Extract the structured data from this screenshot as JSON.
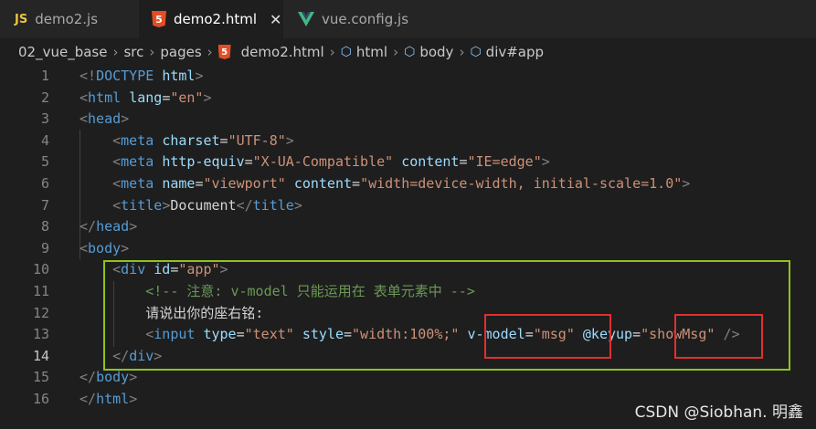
{
  "tabs": [
    {
      "icon": "js-icon",
      "icon_text": "JS",
      "label": "demo2.js",
      "active": false
    },
    {
      "icon": "html5-icon",
      "icon_text": "5",
      "label": "demo2.html",
      "active": true,
      "close": "✕"
    },
    {
      "icon": "vue-icon",
      "icon_text": "",
      "label": "vue.config.js",
      "active": false
    }
  ],
  "breadcrumb": [
    "02_vue_base",
    "src",
    "pages",
    "demo2.html",
    "html",
    "body",
    "div#app"
  ],
  "editor": {
    "current_line": 14,
    "lines": [
      {
        "n": "1",
        "t": [
          [
            "t-punc",
            "<!"
          ],
          [
            "t-tag",
            "DOCTYPE"
          ],
          [
            "t-text",
            " "
          ],
          [
            "t-attr",
            "html"
          ],
          [
            "t-punc",
            ">"
          ]
        ]
      },
      {
        "n": "2",
        "t": [
          [
            "t-punc",
            "<"
          ],
          [
            "t-tag",
            "html"
          ],
          [
            "t-text",
            " "
          ],
          [
            "t-attr",
            "lang"
          ],
          [
            "t-text",
            "="
          ],
          [
            "t-str",
            "\"en\""
          ],
          [
            "t-punc",
            ">"
          ]
        ]
      },
      {
        "n": "3",
        "t": [
          [
            "t-punc",
            "<"
          ],
          [
            "t-tag",
            "head"
          ],
          [
            "t-punc",
            ">"
          ]
        ]
      },
      {
        "n": "4",
        "t": [
          [
            "t-text",
            "    "
          ],
          [
            "t-punc",
            "<"
          ],
          [
            "t-tag",
            "meta"
          ],
          [
            "t-text",
            " "
          ],
          [
            "t-attr",
            "charset"
          ],
          [
            "t-text",
            "="
          ],
          [
            "t-str",
            "\"UTF-8\""
          ],
          [
            "t-punc",
            ">"
          ]
        ]
      },
      {
        "n": "5",
        "t": [
          [
            "t-text",
            "    "
          ],
          [
            "t-punc",
            "<"
          ],
          [
            "t-tag",
            "meta"
          ],
          [
            "t-text",
            " "
          ],
          [
            "t-attr",
            "http-equiv"
          ],
          [
            "t-text",
            "="
          ],
          [
            "t-str",
            "\"X-UA-Compatible\""
          ],
          [
            "t-text",
            " "
          ],
          [
            "t-attr",
            "content"
          ],
          [
            "t-text",
            "="
          ],
          [
            "t-str",
            "\"IE=edge\""
          ],
          [
            "t-punc",
            ">"
          ]
        ]
      },
      {
        "n": "6",
        "t": [
          [
            "t-text",
            "    "
          ],
          [
            "t-punc",
            "<"
          ],
          [
            "t-tag",
            "meta"
          ],
          [
            "t-text",
            " "
          ],
          [
            "t-attr",
            "name"
          ],
          [
            "t-text",
            "="
          ],
          [
            "t-str",
            "\"viewport\""
          ],
          [
            "t-text",
            " "
          ],
          [
            "t-attr",
            "content"
          ],
          [
            "t-text",
            "="
          ],
          [
            "t-str",
            "\"width=device-width, initial-scale=1.0\""
          ],
          [
            "t-punc",
            ">"
          ]
        ]
      },
      {
        "n": "7",
        "t": [
          [
            "t-text",
            "    "
          ],
          [
            "t-punc",
            "<"
          ],
          [
            "t-tag",
            "title"
          ],
          [
            "t-punc",
            ">"
          ],
          [
            "t-text",
            "Document"
          ],
          [
            "t-punc",
            "</"
          ],
          [
            "t-tag",
            "title"
          ],
          [
            "t-punc",
            ">"
          ]
        ]
      },
      {
        "n": "8",
        "t": [
          [
            "t-punc",
            "</"
          ],
          [
            "t-tag",
            "head"
          ],
          [
            "t-punc",
            ">"
          ]
        ]
      },
      {
        "n": "9",
        "t": [
          [
            "t-punc",
            "<"
          ],
          [
            "t-tag",
            "body"
          ],
          [
            "t-punc",
            ">"
          ]
        ]
      },
      {
        "n": "10",
        "t": [
          [
            "t-text",
            "    "
          ],
          [
            "t-punc",
            "<"
          ],
          [
            "t-tag",
            "div"
          ],
          [
            "t-text",
            " "
          ],
          [
            "t-attr",
            "id"
          ],
          [
            "t-text",
            "="
          ],
          [
            "t-str",
            "\"app\""
          ],
          [
            "t-punc",
            ">"
          ]
        ]
      },
      {
        "n": "11",
        "t": [
          [
            "t-text",
            "        "
          ],
          [
            "t-cmt",
            "<!-- 注意: v-model 只能运用在 表单元素中 -->"
          ]
        ]
      },
      {
        "n": "12",
        "t": [
          [
            "t-text",
            "        请说出你的座右铭:"
          ]
        ]
      },
      {
        "n": "13",
        "t": [
          [
            "t-text",
            "        "
          ],
          [
            "t-punc",
            "<"
          ],
          [
            "t-tag",
            "input"
          ],
          [
            "t-text",
            " "
          ],
          [
            "t-attr",
            "type"
          ],
          [
            "t-text",
            "="
          ],
          [
            "t-str",
            "\"text\""
          ],
          [
            "t-text",
            " "
          ],
          [
            "t-attr",
            "style"
          ],
          [
            "t-text",
            "="
          ],
          [
            "t-str",
            "\"width:100%;\""
          ],
          [
            "t-text",
            " "
          ],
          [
            "t-attr",
            "v-model"
          ],
          [
            "t-text",
            "="
          ],
          [
            "t-str",
            "\"msg\""
          ],
          [
            "t-text",
            " "
          ],
          [
            "t-attr",
            "@keyup"
          ],
          [
            "t-text",
            "="
          ],
          [
            "t-str",
            "\"showMsg\""
          ],
          [
            "t-text",
            " "
          ],
          [
            "t-punc",
            "/>"
          ]
        ]
      },
      {
        "n": "14",
        "t": [
          [
            "t-text",
            "    "
          ],
          [
            "t-punc",
            "</"
          ],
          [
            "t-tag",
            "div"
          ],
          [
            "t-punc",
            ">"
          ]
        ]
      },
      {
        "n": "15",
        "t": [
          [
            "t-punc",
            "</"
          ],
          [
            "t-tag",
            "body"
          ],
          [
            "t-punc",
            ">"
          ]
        ]
      },
      {
        "n": "16",
        "t": [
          [
            "t-punc",
            "</"
          ],
          [
            "t-tag",
            "html"
          ],
          [
            "t-punc",
            ">"
          ]
        ]
      }
    ]
  },
  "highlights": {
    "green": "div#app block (lines 10-14)",
    "red": [
      "v-model=\"msg\"",
      "\"showMsg\""
    ]
  },
  "watermark": "CSDN @Siobhan. 明鑫",
  "colors": {
    "highlight_green": "#8fc31f",
    "highlight_red": "#e03030",
    "editor_bg": "#1e1e1e"
  }
}
